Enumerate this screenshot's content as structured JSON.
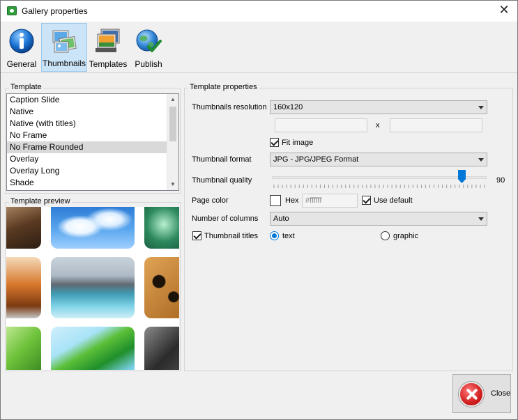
{
  "window": {
    "title": "Gallery properties"
  },
  "toolbar": {
    "tabs": [
      {
        "label": "General",
        "icon": "info-icon"
      },
      {
        "label": "Thumbnails",
        "icon": "thumbnails-icon",
        "active": true
      },
      {
        "label": "Templates",
        "icon": "templates-icon"
      },
      {
        "label": "Publish",
        "icon": "publish-globe-icon"
      }
    ]
  },
  "template": {
    "group_title": "Template",
    "items": [
      "Caption Slide",
      "Native",
      "Native (with titles)",
      "No Frame",
      "No Frame Rounded",
      "Overlay",
      "Overlay Long",
      "Shade"
    ],
    "selected": "No Frame Rounded"
  },
  "preview": {
    "group_title": "Template preview"
  },
  "properties": {
    "group_title": "Template properties",
    "resolution_label": "Thumbnails resolution",
    "resolution_value": "160x120",
    "width_value": "",
    "height_value": "",
    "size_separator": "x",
    "fit_image_label": "Fit image",
    "fit_image_checked": true,
    "format_label": "Thumbnail format",
    "format_value": "JPG - JPG/JPEG Format",
    "quality_label": "Thumbnail quality",
    "quality_value": "90",
    "quality_min": 0,
    "quality_max": 100,
    "page_color_label": "Page color",
    "hex_label": "Hex",
    "hex_checked": false,
    "hex_value": "#ffffff",
    "use_default_label": "Use default",
    "use_default_checked": true,
    "columns_label": "Number of columns",
    "columns_value": "Auto",
    "titles_label": "Thumbnail titles",
    "titles_checked": true,
    "titles_text_label": "text",
    "titles_graphic_label": "graphic",
    "titles_mode": "text"
  },
  "buttons": {
    "close_label": "Close"
  },
  "colors": {
    "accent": "#0078d7",
    "selection": "#cce4f7",
    "list_selected": "#d9d9d9"
  }
}
